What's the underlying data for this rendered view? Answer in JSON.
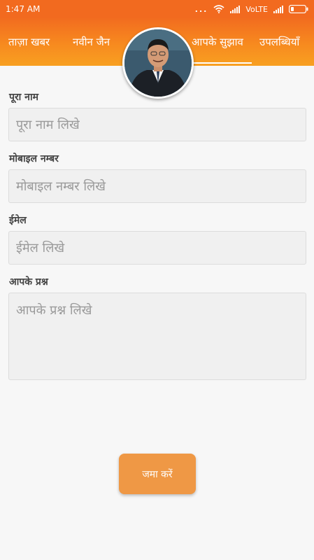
{
  "status_bar": {
    "time": "1:47 AM",
    "dots": "...",
    "network": "VoLTE"
  },
  "tabs": [
    {
      "label": "ताज़ा खबर",
      "active": false
    },
    {
      "label": "नवीन जैन",
      "active": false
    },
    {
      "label": "आपके सुझाव",
      "active": true
    },
    {
      "label": "उपलब्धियाँ",
      "active": false
    }
  ],
  "form": {
    "name_label": "पूरा नाम",
    "name_placeholder": "पूरा नाम लिखे",
    "mobile_label": "मोबाइल नम्बर",
    "mobile_placeholder": "मोबाइल नम्बर लिखे",
    "email_label": "ईमेल",
    "email_placeholder": "ईमेल लिखे",
    "question_label": "आपके प्रश्न",
    "question_placeholder": "आपके प्रश्न लिखे",
    "submit_label": "जमा करें"
  },
  "colors": {
    "header_orange": "#f26c1f",
    "button_orange": "#ef9845"
  }
}
